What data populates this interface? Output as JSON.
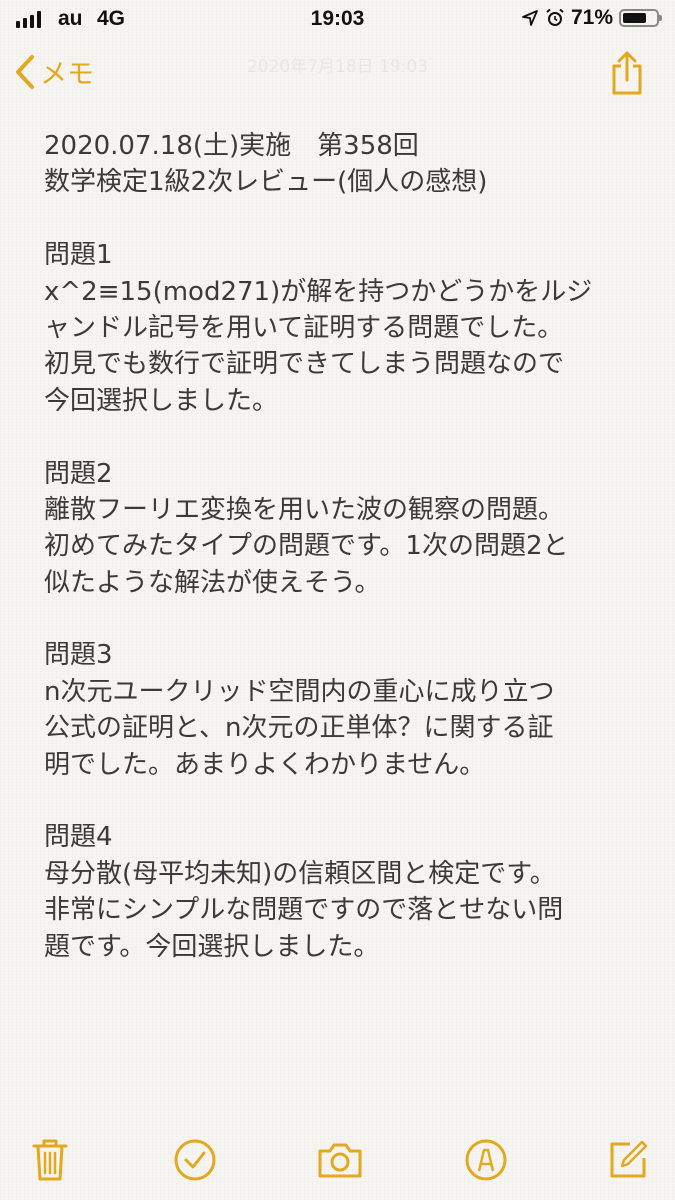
{
  "status_bar": {
    "carrier": "au",
    "network": "4G",
    "time": "19:03",
    "battery_percent": "71%",
    "battery_level": 0.71
  },
  "nav": {
    "back_label": "メモ",
    "faded_title": "2020年7月18日 19:03"
  },
  "note": {
    "lines": [
      "2020.07.18(土)実施　第358回",
      "数学検定1級2次レビュー(個人の感想)",
      "",
      "問題1",
      "x^2≡15(mod271)が解を持つかどうかをルジ",
      "ャンドル記号を用いて証明する問題でした。",
      "初見でも数行で証明できてしまう問題なので",
      "今回選択しました。",
      "",
      "問題2",
      "離散フーリエ変換を用いた波の観察の問題。",
      "初めてみたタイプの問題です。1次の問題2と",
      "似たような解法が使えそう。",
      "",
      "問題3",
      "n次元ユークリッド空間内の重心に成り立つ",
      "公式の証明と、n次元の正単体？に関する証",
      "明でした。あまりよくわかりません。",
      "",
      "問題4",
      "母分散(母平均未知)の信頼区間と検定です。",
      "非常にシンプルな問題ですので落とせない問",
      "題です。今回選択しました。"
    ]
  },
  "toolbar": {
    "accent_color": "#e2a820",
    "icons": [
      "trash-icon",
      "checklist-icon",
      "camera-icon",
      "markup-icon",
      "compose-icon"
    ]
  },
  "accent_color": "#e2a820"
}
